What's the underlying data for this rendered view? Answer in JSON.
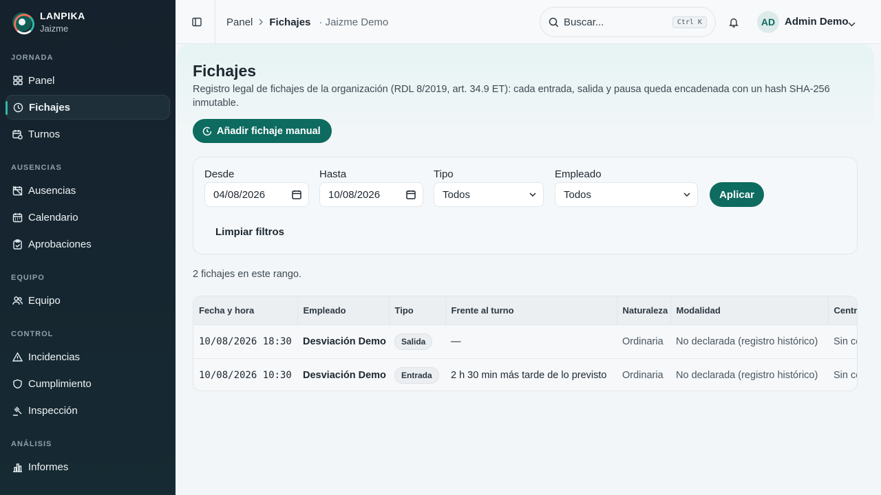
{
  "brand": {
    "name": "LANPIKA",
    "org": "Jaizme"
  },
  "sidebar": {
    "sections": [
      {
        "label": "JORNADA",
        "items": [
          {
            "label": "Panel",
            "icon": "grid-icon"
          },
          {
            "label": "Fichajes",
            "icon": "clock-icon",
            "active": true
          },
          {
            "label": "Turnos",
            "icon": "calendar-clock-icon"
          }
        ]
      },
      {
        "label": "AUSENCIAS",
        "items": [
          {
            "label": "Ausencias",
            "icon": "calendar-off-icon"
          },
          {
            "label": "Calendario",
            "icon": "calendar-icon"
          },
          {
            "label": "Aprobaciones",
            "icon": "clipboard-check-icon"
          }
        ]
      },
      {
        "label": "EQUIPO",
        "items": [
          {
            "label": "Equipo",
            "icon": "users-icon"
          }
        ]
      },
      {
        "label": "CONTROL",
        "items": [
          {
            "label": "Incidencias",
            "icon": "warning-icon"
          },
          {
            "label": "Cumplimiento",
            "icon": "shield-icon"
          },
          {
            "label": "Inspección",
            "icon": "gavel-icon"
          }
        ]
      },
      {
        "label": "ANÁLISIS",
        "items": [
          {
            "label": "Informes",
            "icon": "bar-chart-icon"
          }
        ]
      }
    ]
  },
  "header": {
    "breadcrumb": {
      "root": "Panel",
      "current": "Fichajes",
      "org": "· Jaizme Demo"
    },
    "search": {
      "placeholder": "Buscar...",
      "shortcut": "Ctrl K"
    },
    "user": {
      "initials": "AD",
      "name": "Admin Demo"
    }
  },
  "page": {
    "title": "Fichajes",
    "description": "Registro legal de fichajes de la organización (RDL 8/2019, art. 34.9 ET): cada entrada, salida y pausa queda encadenada con un hash SHA-256 inmutable.",
    "add_button": "Añadir fichaje manual"
  },
  "filters": {
    "from_label": "Desde",
    "from_value": "04/08/2026",
    "to_label": "Hasta",
    "to_value": "10/08/2026",
    "type_label": "Tipo",
    "type_value": "Todos",
    "employee_label": "Empleado",
    "employee_value": "Todos",
    "apply": "Aplicar",
    "clear": "Limpiar filtros"
  },
  "results": {
    "count_text": "2 fichajes en este rango.",
    "columns": [
      "Fecha y hora",
      "Empleado",
      "Tipo",
      "Frente al turno",
      "Naturaleza",
      "Modalidad",
      "Centro"
    ],
    "rows": [
      {
        "datetime": "10/08/2026 18:30",
        "employee": "Desviación Demo",
        "type": "Salida",
        "vs_shift": "—",
        "nature": "Ordinaria",
        "mode": "No declarada (registro histórico)",
        "center": "Sin centro"
      },
      {
        "datetime": "10/08/2026 10:30",
        "employee": "Desviación Demo",
        "type": "Entrada",
        "vs_shift": "2 h 30 min más tarde de lo previsto",
        "nature": "Ordinaria",
        "mode": "No declarada (registro histórico)",
        "center": "Sin centro"
      }
    ]
  },
  "colors": {
    "accent": "#0e6b60",
    "sidebar_bg": "#15212c",
    "active_marker": "#2fb9a7"
  }
}
